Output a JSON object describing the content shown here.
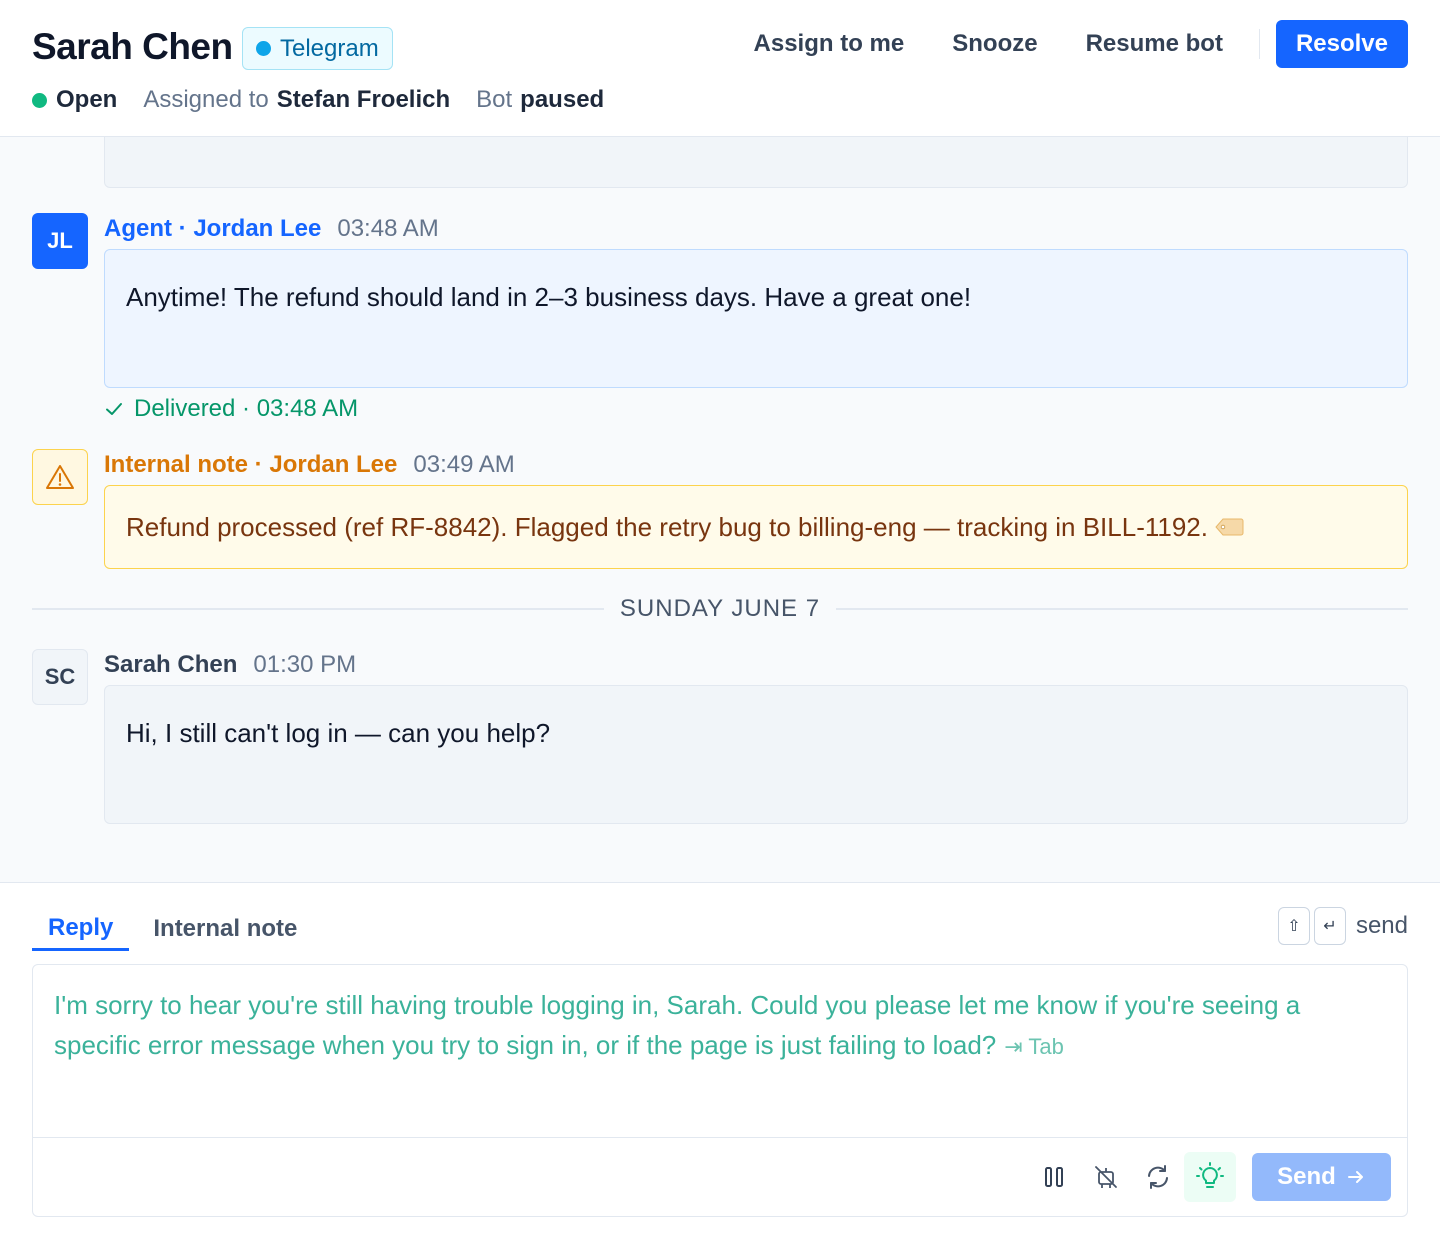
{
  "header": {
    "contact_name": "Sarah Chen",
    "channel": "Telegram",
    "actions": {
      "assign": "Assign to me",
      "snooze": "Snooze",
      "resume_bot": "Resume bot",
      "resolve": "Resolve"
    },
    "status": "Open",
    "assigned_prefix": "Assigned to",
    "assignee": "Stefan Froelich",
    "bot_prefix": "Bot",
    "bot_state": "paused"
  },
  "messages": [
    {
      "avatar": "JL",
      "author": "Agent · Jordan Lee",
      "time": "03:48 AM",
      "text": "Anytime! The refund should land in 2–3 business days. Have a great one!",
      "delivery": "Delivered · 03:48 AM"
    },
    {
      "author": "Internal note · Jordan Lee",
      "time": "03:49 AM",
      "text": "Refund processed (ref RF-8842). Flagged the retry bug to billing-eng — tracking in BILL-1192.",
      "icon": "warning-icon"
    },
    {
      "avatar": "SC",
      "author": "Sarah Chen",
      "time": "01:30 PM",
      "text": "Hi, I still can't log in — can you help?"
    }
  ],
  "day_separator": "SUNDAY JUNE 7",
  "composer": {
    "tabs": [
      "Reply",
      "Internal note"
    ],
    "active_tab": "Reply",
    "send_hint": "send",
    "kbd_keys": [
      "⇧",
      "↵"
    ],
    "suggestion": "I'm sorry to hear you're still having trouble logging in, Sarah. Could you please let me know if you're seeing a specific error message when you try to sign in, or if the page is just failing to load?",
    "accept_hint": "⇥ Tab",
    "send_label": "Send"
  },
  "colors": {
    "primary": "#1565ff",
    "open_status": "#10b981",
    "note_accent": "#d97706",
    "suggestion_text": "#3bb29a",
    "telegram": "#0ea5e9"
  }
}
